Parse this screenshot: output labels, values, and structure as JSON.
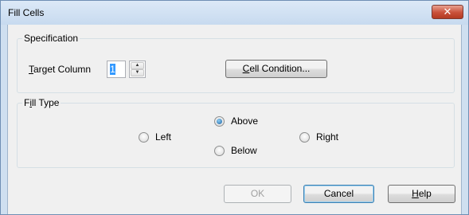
{
  "window": {
    "title": "Fill Cells",
    "close_glyph": "✕"
  },
  "specification": {
    "legend": "Specification",
    "target_column_label_mnemonic": "T",
    "target_column_label_rest": "arget Column",
    "target_column_value": "1",
    "cell_condition_mnemonic": "C",
    "cell_condition_rest": "ell Condition..."
  },
  "fill_type": {
    "legend_pre": "F",
    "legend_mnemonic": "i",
    "legend_rest": "ll Type",
    "options": {
      "left": "Left",
      "above": "Above",
      "below": "Below",
      "right": "Right"
    },
    "selected": "above"
  },
  "buttons": {
    "ok": "OK",
    "cancel": "Cancel",
    "help_mnemonic": "H",
    "help_rest": "elp"
  },
  "colors": {
    "accent": "#3399ff",
    "close_red": "#c9503a"
  },
  "icons": {
    "spin_up": "▲",
    "spin_down": "▼"
  }
}
